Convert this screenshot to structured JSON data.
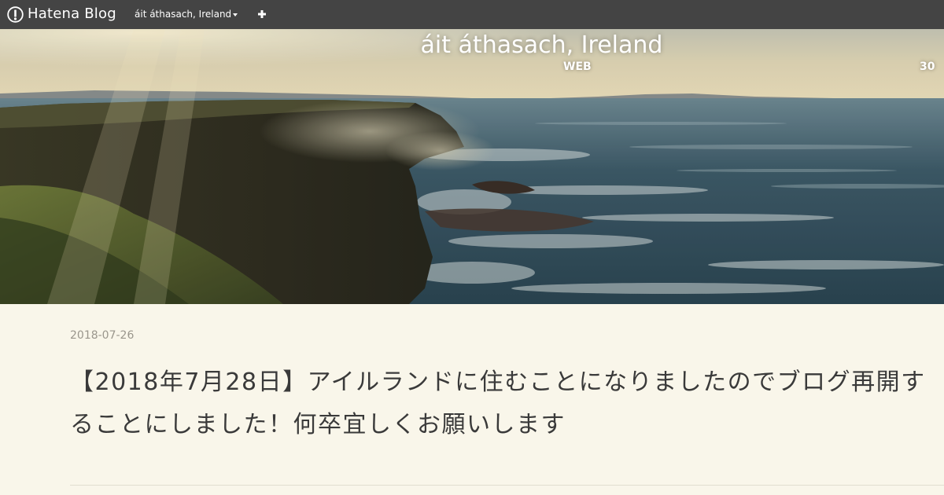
{
  "topbar": {
    "brand": "Hatena Blog",
    "blog_menu": "áit áthasach, Ireland",
    "add_icon": "plus-icon",
    "brand_icon": "hatena-pen-icon"
  },
  "header": {
    "title": "áit áthasach, Ireland",
    "description": "WEB",
    "corner_text": "30"
  },
  "entry": {
    "date": "2018-07-26",
    "title": "【2018年7月28日】アイルランドに住むことになりましたのでブログ再開することにしました！何卒宜しくお願いします"
  },
  "colors": {
    "topbar_bg": "#444444",
    "page_bg": "#f9f6ea",
    "title_text": "#3a3a3a",
    "date_text": "#9a968c"
  }
}
